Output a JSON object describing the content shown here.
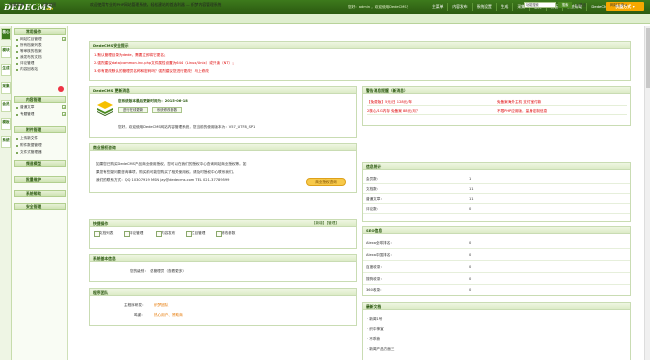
{
  "app": {
    "logo": "DEDECMS",
    "logo_version": "v5.7"
  },
  "topbar": {
    "user_tip": "您好：admin ，欢迎使用DedeCMS！",
    "nav": [
      "主菜单",
      "内容发布",
      "系统设置",
      "生成",
      "采集",
      "会员",
      "模板",
      "系统帮助",
      "DedeCMS官网"
    ],
    "quick_button": "快捷方式 ▾"
  },
  "subbar": {
    "links": [
      "隐藏菜单",
      "功能地图"
    ],
    "welcome": "欢迎使用专业的PHP网站管理系统，轻松建站的首选利器 — 织梦内容管理系统",
    "search_placeholder": "功能搜索",
    "search_button": "搜索",
    "exit_link": "◂ 退出",
    "site_link": "网站主页 ▸"
  },
  "vtabs": [
    "核心",
    "模块",
    "生成",
    "采集",
    "会员",
    "模板",
    "系统"
  ],
  "leftmenu": {
    "sections": [
      {
        "title": "常用操作",
        "items": [
          "网站栏目管理",
          "所有档案列表",
          "等审核的档案",
          "我发布的文档",
          "评论管理",
          "内容回收站"
        ]
      },
      {
        "title": "内容管理",
        "items": [
          "普通文章",
          "专题管理"
        ]
      },
      {
        "title": "附件管理",
        "items": [
          "上传新文件",
          "附件数据管理",
          "文件式管理器"
        ]
      },
      {
        "title": "频道模型",
        "items": []
      },
      {
        "title": "批量维护",
        "items": []
      },
      {
        "title": "系统帮助",
        "items": []
      },
      {
        "title": "安全管理",
        "items": []
      }
    ]
  },
  "security_panel": {
    "title": "DedeCMS安全提示",
    "lines": [
      "1.默认管理目录为dede，需要立即将它更名；",
      "2.强烈建议data/common.inc.php文件属性设置为644（Linux/Unix）或只读（NT）；",
      "3.你有更改默认的管理员名称和密码吗？强烈建议您进行更改！马上修改"
    ]
  },
  "update_panel": {
    "title": "DedeCMS 更新消息",
    "heading": "您系统版本最后更新时间为：2015-06-18",
    "btn_check": "进行在线更新",
    "btn_info": "系统修改参数",
    "line": "您好，欢迎使用DedeCMS网站内容管理系统，您当前的使用版本为：V57_UTF8_SP1"
  },
  "license_panel": {
    "title": "商业授权咨询",
    "lines": [
      "如果您已购买DedeCMS产品商业使用授权，您可以在我们的授权中心查询网站商业授权等。如",
      "果您有些疑问要咨询事项，购买前可能您购买了相关使用权。请及时授权中心联系我们。",
      "我们的联系方式：QQ 10307919 MSN jay@dedecms.com TEL 021-37789599"
    ],
    "button": "商业授权咨询"
  },
  "quick_panel": {
    "title": "快捷操作",
    "right_links": "【新增】【管理】",
    "buttons": [
      "文档列表",
      "评论管理",
      "内容发布",
      "栏目管理",
      "修改参数"
    ]
  },
  "sysinfo_panel": {
    "title": "系统基本信息",
    "label": "您的级别：",
    "value": "总管理员（查看更多）"
  },
  "team_panel": {
    "title": "程序团队",
    "rows": [
      {
        "label": "主程序研发：",
        "value": "织梦团队"
      },
      {
        "label": "鸣谢：",
        "value": "热心用户、赞助商"
      }
    ]
  },
  "messages_panel": {
    "title": "警告消息提醒（新消息）",
    "rows": [
      {
        "left": "【免费版】5元/日 128元/年",
        "right": "免备案海外主机 支付宝付款"
      },
      {
        "left": "2核心/1G内存 免备案 88元/月？",
        "right": "不限PHP应用版，量身定制信息"
      }
    ]
  },
  "stats_panel": {
    "title": "信息统计",
    "rows": [
      {
        "label": "会员数：",
        "value": "1"
      },
      {
        "label": "文档数：",
        "value": "11"
      },
      {
        "label": "普通文章：",
        "value": "11"
      },
      {
        "label": "评论数：",
        "value": "0"
      }
    ]
  },
  "seo_panel": {
    "title": "SEO信息",
    "rows": [
      {
        "label": "Alexa全球排名：",
        "value": "0"
      },
      {
        "label": "Alexa中国排名：",
        "value": "0"
      },
      {
        "label": "百度收录：",
        "value": "0"
      },
      {
        "label": "搜狗收录：",
        "value": "0"
      },
      {
        "label": "360收录：",
        "value": "0"
      }
    ]
  },
  "latest_panel": {
    "title": "最新文档",
    "items": [
      "· 新闻1号",
      "· 织中神宣",
      "· 不乖熊",
      "· 新闻产品方面三"
    ]
  },
  "colors": {
    "brand_green": "#3d7a1c",
    "accent_orange": "#f7a800"
  }
}
